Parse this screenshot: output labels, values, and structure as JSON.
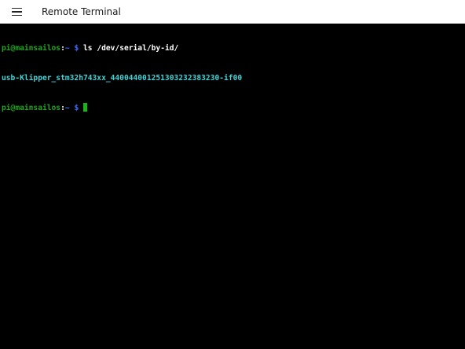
{
  "window": {
    "title": "Remote Terminal"
  },
  "terminal": {
    "prompt_user_host": "pi@mainsailos",
    "prompt_separator": ":",
    "prompt_path": "~",
    "prompt_symbol": "$",
    "lines": [
      {
        "command": "ls /dev/serial/by-id/"
      },
      {
        "output": "usb-Klipper_stm32h743xx_440044001251303232383230-if00"
      },
      {
        "command": ""
      }
    ]
  },
  "colors": {
    "prompt_user": "#1fa51f",
    "prompt_path": "#3b6cff",
    "output": "#3fd4d8",
    "cursor": "#18b418",
    "background": "#000000",
    "titlebar": "#ffffff"
  },
  "icons": {
    "menu": "hamburger-menu-icon"
  }
}
